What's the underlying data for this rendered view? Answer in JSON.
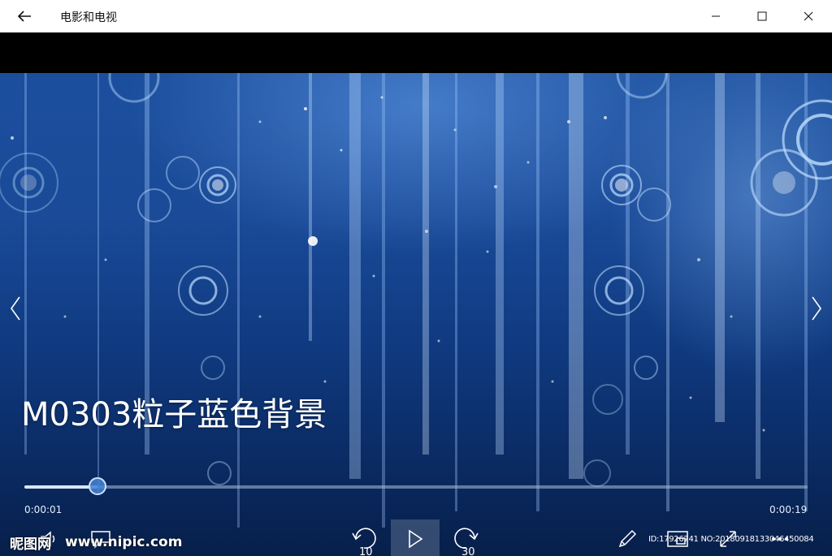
{
  "app": {
    "title": "电影和电视"
  },
  "video": {
    "title": "M0303粒子蓝色背景",
    "progress": 0.093
  },
  "player": {
    "elapsed": "0:00:01",
    "total": "0:00:19",
    "skip_back_seconds": "10",
    "skip_forward_seconds": "30"
  },
  "watermark": {
    "site_name": "昵图网",
    "url": "www.nipic.com",
    "id_text": "ID:17926741 NO:20180918133046450084"
  },
  "icons": {
    "back": "arrow-left-icon",
    "minimize": "minimize-icon",
    "maximize": "maximize-icon",
    "close": "close-icon",
    "previous": "chevron-left-icon",
    "next": "chevron-right-icon",
    "volume": "volume-icon",
    "subtitles": "subtitles-icon",
    "skip_back": "skip-back-10-icon",
    "play": "play-icon",
    "skip_forward": "skip-forward-30-icon",
    "edit": "pencil-icon",
    "mini_view": "mini-view-icon",
    "fullscreen": "fullscreen-icon",
    "more": "more-icon"
  }
}
